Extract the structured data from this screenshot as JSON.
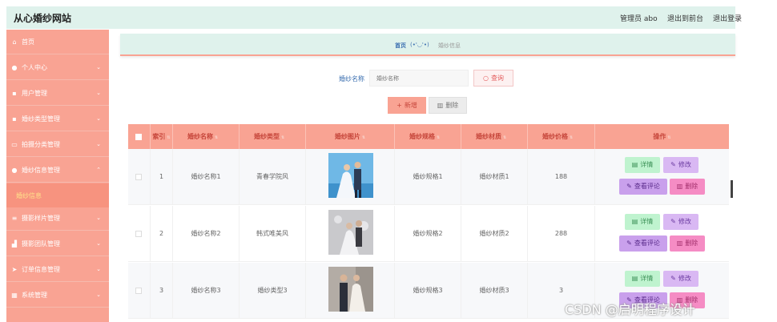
{
  "header": {
    "site_title": "从心婚纱网站",
    "user_label": "管理员 abo",
    "front_link": "退出到前台",
    "logout_link": "退出登录"
  },
  "sidebar": {
    "items": [
      {
        "label": "首页",
        "icon": "home-icon",
        "has_arrow": false
      },
      {
        "label": "个人中心",
        "icon": "person-icon",
        "has_arrow": true
      },
      {
        "label": "用户管理",
        "icon": "user-card-icon",
        "has_arrow": true
      },
      {
        "label": "婚纱类型管理",
        "icon": "card-icon",
        "has_arrow": true
      },
      {
        "label": "拍摄分类管理",
        "icon": "message-icon",
        "has_arrow": true
      },
      {
        "label": "婚纱信息管理",
        "icon": "person-icon",
        "has_arrow": true,
        "expanded": true
      },
      {
        "label": "摄影样片管理",
        "icon": "list-icon",
        "has_arrow": true
      },
      {
        "label": "摄影团队管理",
        "icon": "chart-icon",
        "has_arrow": true
      },
      {
        "label": "订单信息管理",
        "icon": "send-icon",
        "has_arrow": true
      },
      {
        "label": "系统管理",
        "icon": "grid-icon",
        "has_arrow": true
      }
    ],
    "subitem": "婚纱信息"
  },
  "breadcrumb": {
    "home": "首页",
    "face": "(•'◡'•)",
    "current": "婚纱信息"
  },
  "search": {
    "label": "婚纱名称",
    "placeholder": "婚纱名称",
    "button": "查询",
    "add_button": "新增",
    "delete_button": "删除"
  },
  "table": {
    "columns": [
      "索引",
      "婚纱名称",
      "婚纱类型",
      "婚纱图片",
      "婚纱规格",
      "婚纱材质",
      "婚纱价格",
      "操作"
    ],
    "rows": [
      {
        "index": "1",
        "name": "婚纱名称1",
        "type": "青春学院风",
        "spec": "婚纱规格1",
        "material": "婚纱材质1",
        "price": "188"
      },
      {
        "index": "2",
        "name": "婚纱名称2",
        "type": "韩式唯美风",
        "spec": "婚纱规格2",
        "material": "婚纱材质2",
        "price": "288"
      },
      {
        "index": "3",
        "name": "婚纱名称3",
        "type": "婚纱类型3",
        "spec": "婚纱规格3",
        "material": "婚纱材质3",
        "price": "3"
      }
    ],
    "actions": {
      "detail": "详情",
      "edit": "修改",
      "review": "查看评论",
      "delete": "删除"
    }
  },
  "watermark": "CSDN @启明程序设计",
  "colors": {
    "accent": "#f9a393",
    "header_bg": "#dff2ec"
  }
}
